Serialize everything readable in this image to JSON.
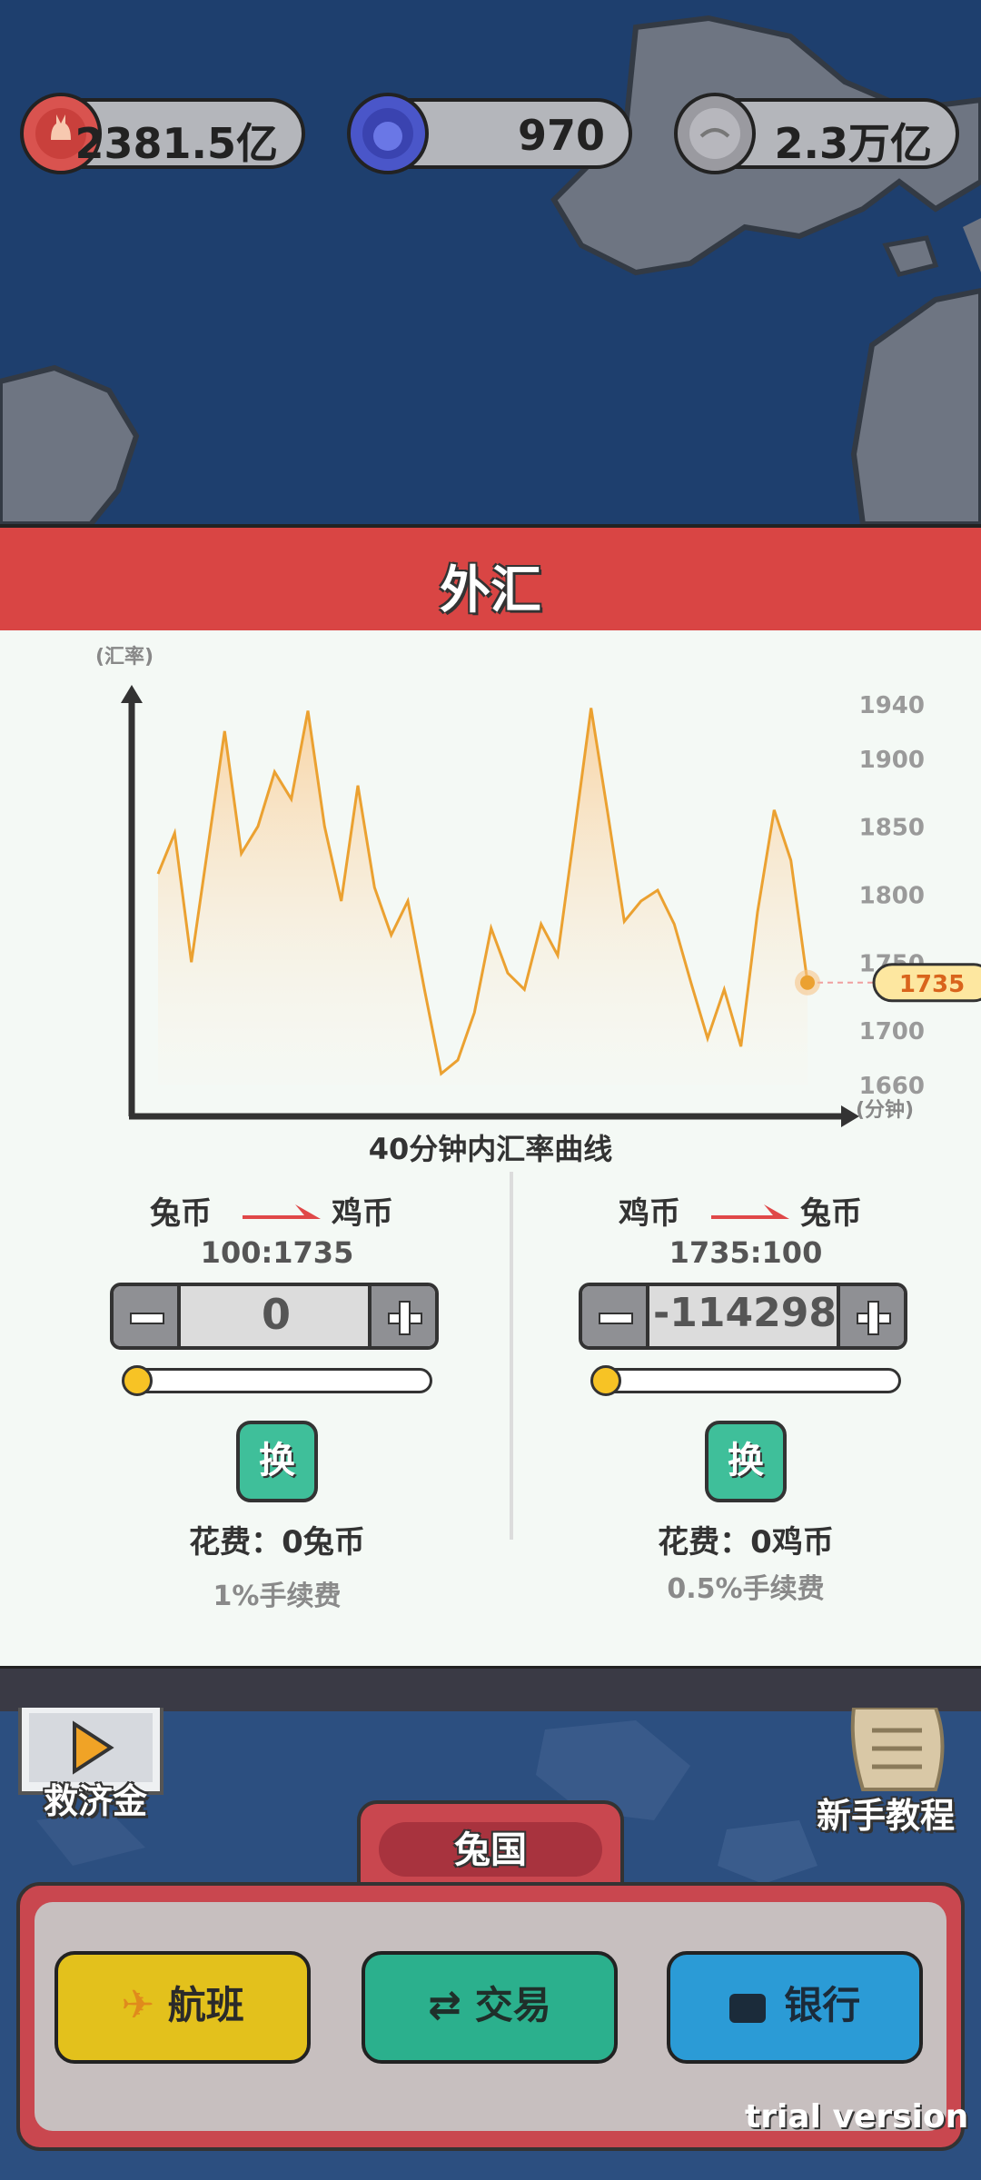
{
  "currencies": [
    {
      "value": "2381.5亿",
      "color": "#d9534f",
      "icon": "rabbit-coin-icon"
    },
    {
      "value": "970",
      "color": "#4a56c9",
      "icon": "blue-coin-icon"
    },
    {
      "value": "2.3万亿",
      "color": "#9a9aa0",
      "icon": "silver-coin-icon"
    }
  ],
  "panel": {
    "title": "外汇",
    "chart_caption": "40分钟内汇率曲线"
  },
  "chart_data": {
    "type": "line",
    "ylabel": "(汇率)",
    "xlabel": "(分钟)",
    "ylim": [
      1660,
      1940
    ],
    "yticks": [
      "1940",
      "1900",
      "1850",
      "1800",
      "1750",
      "1700",
      "1660"
    ],
    "current_value": "1735",
    "y": [
      1815,
      1845,
      1750,
      1835,
      1920,
      1830,
      1850,
      1890,
      1870,
      1935,
      1850,
      1795,
      1880,
      1805,
      1770,
      1795,
      1730,
      1668,
      1678,
      1713,
      1775,
      1742,
      1730,
      1778,
      1755,
      1845,
      1937,
      1860,
      1780,
      1795,
      1803,
      1778,
      1735,
      1694,
      1730,
      1688,
      1787,
      1862,
      1825,
      1735
    ]
  },
  "exchange": [
    {
      "from": "兔币",
      "to": "鸡币",
      "ratio": "100:1735",
      "amount": "0",
      "swap_label": "换",
      "cost": "花费：0兔币",
      "fee": "1%手续费"
    },
    {
      "from": "鸡币",
      "to": "兔币",
      "ratio": "1735:100",
      "amount": "-114298",
      "swap_label": "换",
      "cost": "花费：0鸡币",
      "fee": "0.5%手续费"
    }
  ],
  "bottom": {
    "relief_label": "救济金",
    "tutorial_label": "新手教程",
    "country_tab": "兔国",
    "buttons": [
      {
        "label": "航班",
        "icon": "plane-icon",
        "color": "#e3c11c"
      },
      {
        "label": "交易",
        "icon": "exchange-arrows-icon",
        "color": "#2bb08d"
      },
      {
        "label": "银行",
        "icon": "wallet-icon",
        "color": "#2b9bd6"
      }
    ],
    "watermark": "trial version"
  }
}
